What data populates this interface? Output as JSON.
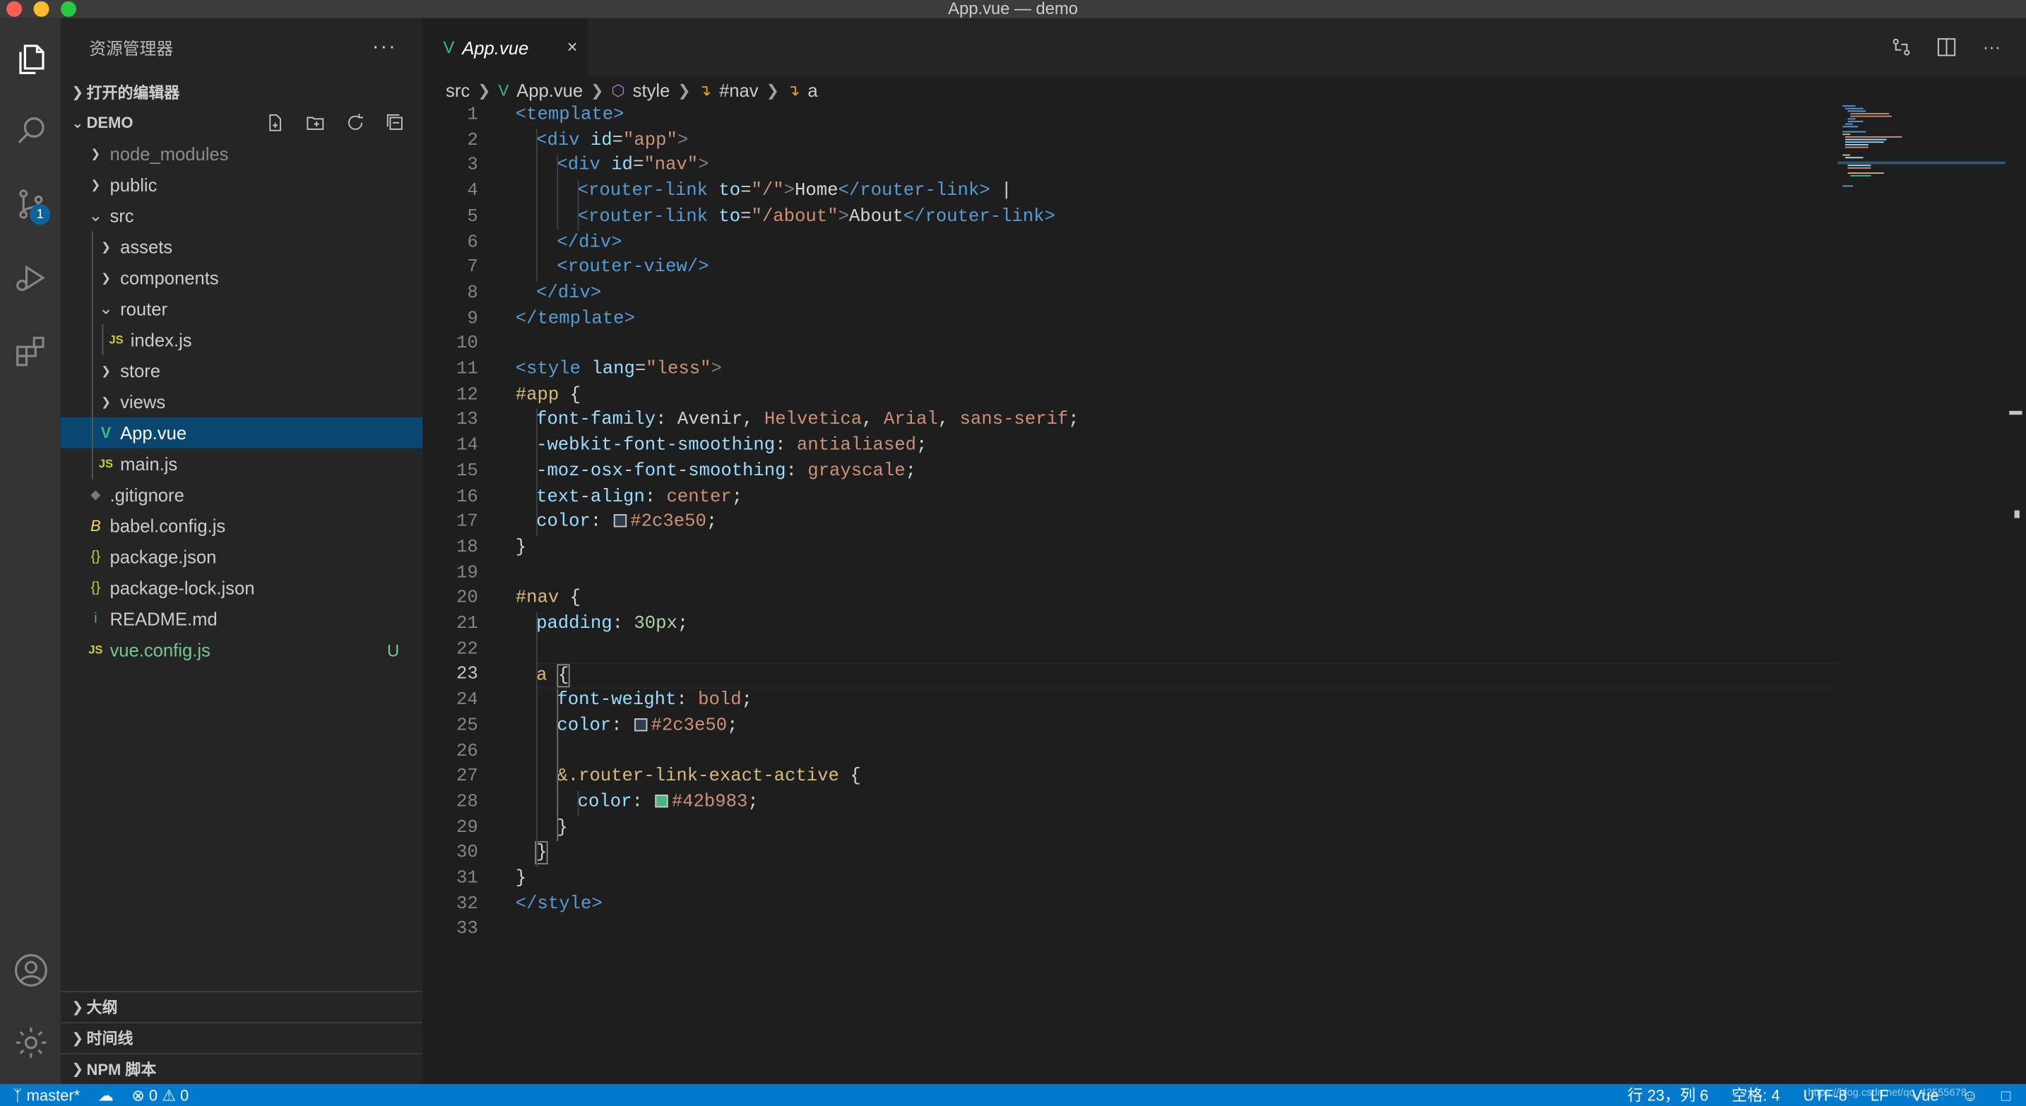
{
  "window": {
    "title": "App.vue — demo"
  },
  "activity": {
    "scm_badge": "1"
  },
  "sidebar": {
    "title": "资源管理器",
    "more": "···",
    "open_editors": "打开的编辑器",
    "workspace": "DEMO",
    "tree": [
      {
        "label": "node_modules",
        "icon": ">",
        "depth": 0
      },
      {
        "label": "public",
        "icon": ">",
        "depth": 0
      },
      {
        "label": "src",
        "icon": "v",
        "depth": 0
      },
      {
        "label": "assets",
        "icon": ">",
        "depth": 1
      },
      {
        "label": "components",
        "icon": ">",
        "depth": 1
      },
      {
        "label": "router",
        "icon": "v",
        "depth": 1
      },
      {
        "label": "index.js",
        "icon": "JS",
        "depth": 2
      },
      {
        "label": "store",
        "icon": ">",
        "depth": 1
      },
      {
        "label": "views",
        "icon": ">",
        "depth": 1
      },
      {
        "label": "App.vue",
        "icon": "V",
        "depth": 1
      },
      {
        "label": "main.js",
        "icon": "JS",
        "depth": 1
      },
      {
        "label": ".gitignore",
        "icon": "◆",
        "depth": 0
      },
      {
        "label": "babel.config.js",
        "icon": "B",
        "depth": 0
      },
      {
        "label": "package.json",
        "icon": "{}",
        "depth": 0
      },
      {
        "label": "package-lock.json",
        "icon": "{}",
        "depth": 0
      },
      {
        "label": "README.md",
        "icon": "i",
        "depth": 0
      },
      {
        "label": "vue.config.js",
        "icon": "JS",
        "depth": 0,
        "git": "U"
      }
    ],
    "bottom_sections": [
      "大纲",
      "时间线",
      "NPM 脚本"
    ]
  },
  "editor": {
    "tab_label": "App.vue",
    "tab_close": "×",
    "breadcrumb": [
      "src",
      "App.vue",
      "style",
      "#nav",
      "a"
    ],
    "lines": [
      "1",
      "2",
      "3",
      "4",
      "5",
      "6",
      "7",
      "8",
      "9",
      "10",
      "11",
      "12",
      "13",
      "14",
      "15",
      "16",
      "17",
      "18",
      "19",
      "20",
      "21",
      "22",
      "23",
      "24",
      "25",
      "26",
      "27",
      "28",
      "29",
      "30",
      "31",
      "32",
      "33"
    ],
    "code": {
      "l1": "<template>",
      "l2a": "<div",
      "l2b": "id",
      "l2c": "\"app\"",
      "l3a": "<div",
      "l3b": "id",
      "l3c": "\"nav\"",
      "l4a": "<router-link",
      "l4b": "to",
      "l4c": "\"/\"",
      "l4d": "Home",
      "l4e": "</router-link>",
      "l4f": " |",
      "l5a": "<router-link",
      "l5b": "to",
      "l5c": "\"/about\"",
      "l5d": "About",
      "l5e": "</router-link>",
      "l6": "</div>",
      "l7": "<router-view/>",
      "l8": "</div>",
      "l9": "</template>",
      "l11a": "<style",
      "l11b": "lang",
      "l11c": "\"less\"",
      "l12": "#app",
      "l13a": "font-family",
      "l13b": "Avenir, ",
      "l13c": "Helvetica",
      "l13d": "Arial",
      "l13e": "sans-serif",
      "l14a": "-webkit-font-smoothing",
      "l14b": "antialiased",
      "l15a": "-moz-osx-font-smoothing",
      "l15b": "grayscale",
      "l16a": "text-align",
      "l16b": "center",
      "l17a": "color",
      "l17b": "#2c3e50",
      "l20": "#nav",
      "l21a": "padding",
      "l21b": "30px",
      "l23": "a",
      "l24a": "font-weight",
      "l24b": "bold",
      "l25a": "color",
      "l25b": "#2c3e50",
      "l27": "&.router-link-exact-active",
      "l28a": "color",
      "l28b": "#42b983",
      "l32": "</style>"
    }
  },
  "status": {
    "branch": "master*",
    "problems": "0",
    "warnings": "0",
    "position": "行 23，列 6",
    "spaces": "空格: 4",
    "encoding": "UTF-8",
    "eol": "LF",
    "language": "Vue",
    "watermark": "https://blog.csdn.net/qq_42555678"
  },
  "colors": {
    "accent": "#007acc",
    "vue": "#41b883",
    "selection": "#094771",
    "swatch1": "#2c3e50",
    "swatch2": "#42b983"
  }
}
